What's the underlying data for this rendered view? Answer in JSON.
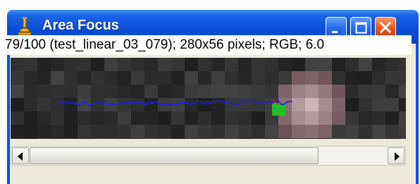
{
  "window": {
    "title": "Area Focus",
    "icon": "microscope-icon"
  },
  "info_bar": {
    "text": "79/100 (test_linear_03_079); 280x56 pixels; RGB; 6.0"
  },
  "title_buttons": {
    "minimize": "minimize-icon",
    "maximize": "maximize-icon",
    "close": "close-icon"
  },
  "image": {
    "trace_color": "#1a1aff",
    "marker_color": "#22c022"
  },
  "scrollbar": {
    "position": 0.79
  }
}
